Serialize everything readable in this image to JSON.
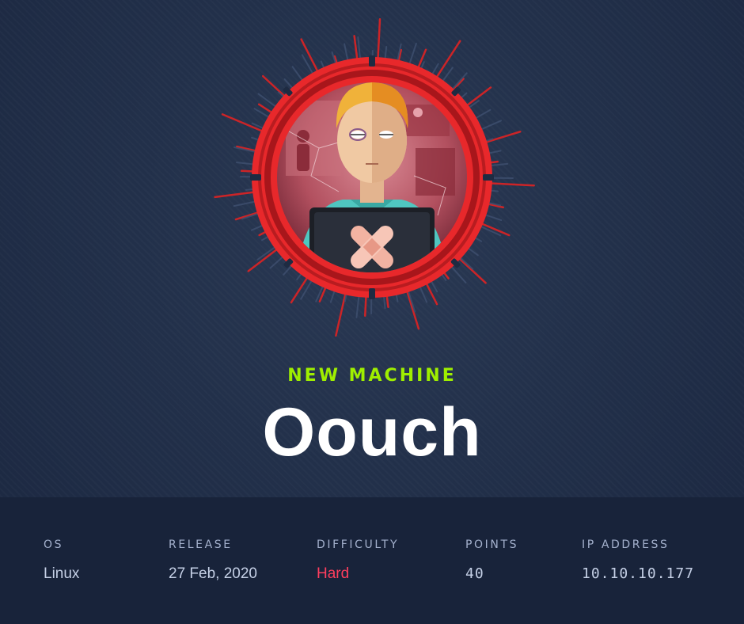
{
  "header": {
    "tag": "NEW MACHINE",
    "machine_name": "Oouch"
  },
  "badge": {
    "icon": "hacker-avatar-badge-icon",
    "accent_color": "#e8282b",
    "ray_color": "#cc2427"
  },
  "info": {
    "os_label": "OS",
    "os_value": "Linux",
    "release_label": "RELEASE",
    "release_value": "27 Feb, 2020",
    "difficulty_label": "DIFFICULTY",
    "difficulty_value": "Hard",
    "points_label": "POINTS",
    "points_value": "40",
    "ip_label": "IP ADDRESS",
    "ip_value": "10.10.10.177"
  },
  "colors": {
    "tag": "#9fef00",
    "hard": "#ff3e5e",
    "label": "#a4b1cd"
  }
}
